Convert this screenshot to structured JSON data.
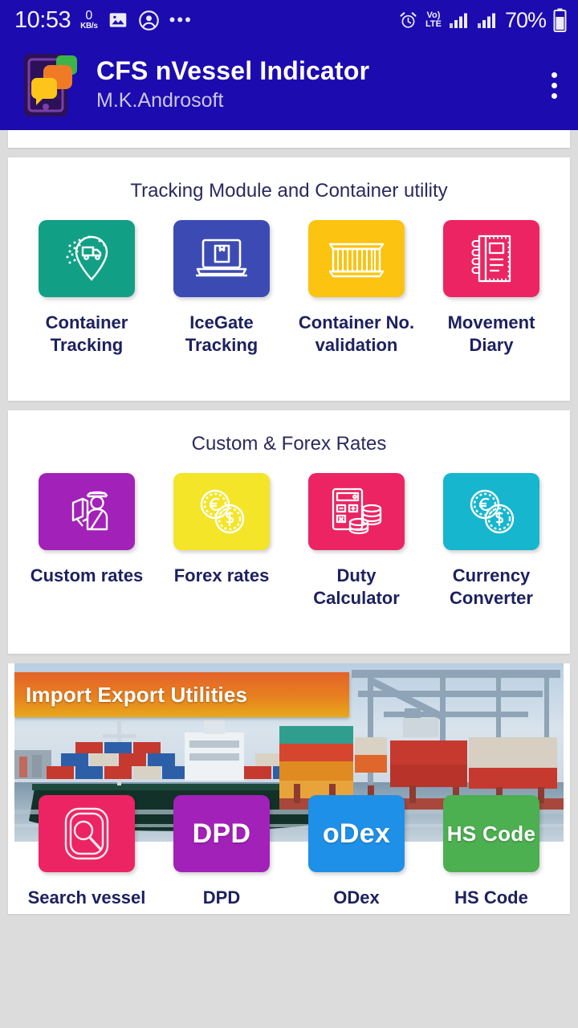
{
  "status_bar": {
    "time": "10:53",
    "net_speed_value": "0",
    "net_speed_unit": "KB/s",
    "icons": [
      "image-icon",
      "account-icon",
      "more-dots-icon",
      "alarm-icon"
    ],
    "volte_top": "Vo)",
    "volte_bottom": "LTE",
    "battery_percent": "70%"
  },
  "app_bar": {
    "title": "CFS nVessel Indicator",
    "subtitle": "M.K.Androsoft",
    "overflow_icon": "kebab-menu-icon",
    "logo_icon": "app-logo-icon",
    "background_color": "#1C0BAF"
  },
  "sections": [
    {
      "title": "Tracking Module and Container utility",
      "items": [
        {
          "label": "Container Tracking",
          "icon": "truck-location-pin-icon",
          "color": "#11A085"
        },
        {
          "label": "IceGate Tracking",
          "icon": "laptop-package-icon",
          "color": "#3C4BB4"
        },
        {
          "label": "Container No. validation",
          "icon": "shipping-container-icon",
          "color": "#FCC310"
        },
        {
          "label": "Movement Diary",
          "icon": "spiral-notebook-icon",
          "color": "#EC2463"
        }
      ]
    },
    {
      "title": "Custom & Forex Rates",
      "items": [
        {
          "label": "Custom rates",
          "icon": "customs-officer-icon",
          "color": "#A221B8"
        },
        {
          "label": "Forex rates",
          "icon": "two-coins-icon",
          "color": "#F5E529"
        },
        {
          "label": "Duty Calculator",
          "icon": "calculator-coins-icon",
          "color": "#EC2463"
        },
        {
          "label": "Currency Converter",
          "icon": "currency-exchange-icon",
          "color": "#16B6CF"
        }
      ]
    }
  ],
  "banner": {
    "ribbon_title": "Import Export Utilities",
    "image_alt": "container-ship-port-photo",
    "items": [
      {
        "label": "Search vessel",
        "tile_text": "",
        "icon": "magnifier-search-icon",
        "color": "#EC2463"
      },
      {
        "label": "DPD",
        "tile_text": "DPD",
        "icon": "dpd-text-icon",
        "color": "#A221B8"
      },
      {
        "label": "ODex",
        "tile_text": "oDex",
        "icon": "odex-text-icon",
        "color": "#1E90E8"
      },
      {
        "label": "HS Code",
        "tile_text": "HS Code",
        "icon": "hs-code-text-icon",
        "color": "#4CAF50"
      }
    ]
  }
}
